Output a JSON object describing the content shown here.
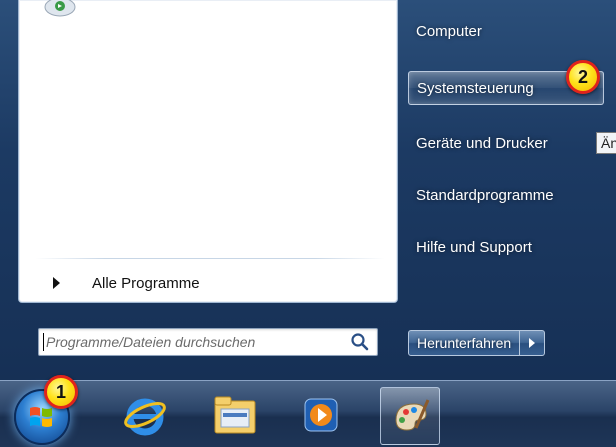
{
  "left_pane": {
    "all_programs_label": "Alle Programme",
    "search_placeholder": "Programme/Dateien durchsuchen"
  },
  "right_pane": {
    "items": [
      {
        "label": "Computer"
      },
      {
        "label": "Systemsteuerung",
        "highlighted": true
      },
      {
        "label": "Geräte und Drucker"
      },
      {
        "label": "Standardprogramme"
      },
      {
        "label": "Hilfe und Support"
      }
    ],
    "tooltip_fragment": "Än",
    "shutdown_label": "Herunterfahren"
  },
  "badges": {
    "start_badge": "1",
    "control_panel_badge": "2"
  },
  "taskbar": {
    "buttons": [
      {
        "name": "start-orb",
        "icon": "windows-logo-icon"
      },
      {
        "name": "internet-explorer",
        "icon": "internet-explorer-icon"
      },
      {
        "name": "file-explorer",
        "icon": "folder-icon"
      },
      {
        "name": "media-player",
        "icon": "media-player-icon"
      },
      {
        "name": "paint",
        "icon": "paint-palette-icon",
        "active": true
      }
    ]
  },
  "colors": {
    "badge_fill": "#ffe21a",
    "badge_ring": "#e0231b",
    "menu_glass": "#1c3a63"
  }
}
